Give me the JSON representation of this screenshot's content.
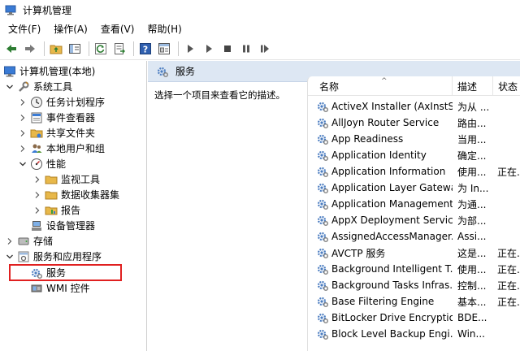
{
  "window": {
    "title": "计算机管理"
  },
  "menu": [
    "文件(F)",
    "操作(A)",
    "查看(V)",
    "帮助(H)"
  ],
  "tree": {
    "root": "计算机管理(本地)",
    "system_tools": "系统工具",
    "task_scheduler": "任务计划程序",
    "event_viewer": "事件查看器",
    "shared_folders": "共享文件夹",
    "local_users": "本地用户和组",
    "performance": "性能",
    "monitor_tools": "监视工具",
    "data_collector": "数据收集器集",
    "reports": "报告",
    "device_manager": "设备管理器",
    "storage": "存储",
    "services_apps": "服务和应用程序",
    "services": "服务",
    "wmi": "WMI 控件"
  },
  "main": {
    "header": "服务",
    "description": "选择一个项目来查看它的描述。",
    "columns": {
      "name": "名称",
      "desc": "描述",
      "status": "状态"
    },
    "sort_indicator": "^",
    "services": [
      {
        "name": "ActiveX Installer (AxInstSV)",
        "desc": "为从 ...",
        "status": ""
      },
      {
        "name": "AllJoyn Router Service",
        "desc": "路由...",
        "status": ""
      },
      {
        "name": "App Readiness",
        "desc": "当用...",
        "status": ""
      },
      {
        "name": "Application Identity",
        "desc": "确定...",
        "status": ""
      },
      {
        "name": "Application Information",
        "desc": "使用...",
        "status": "正在..."
      },
      {
        "name": "Application Layer Gatewa...",
        "desc": "为 In...",
        "status": ""
      },
      {
        "name": "Application Management",
        "desc": "为通...",
        "status": ""
      },
      {
        "name": "AppX Deployment Servic...",
        "desc": "为部...",
        "status": ""
      },
      {
        "name": "AssignedAccessManager...",
        "desc": "Assi...",
        "status": ""
      },
      {
        "name": "AVCTP 服务",
        "desc": "这是...",
        "status": "正在..."
      },
      {
        "name": "Background Intelligent T...",
        "desc": "使用...",
        "status": "正在..."
      },
      {
        "name": "Background Tasks Infras...",
        "desc": "控制...",
        "status": "正在..."
      },
      {
        "name": "Base Filtering Engine",
        "desc": "基本...",
        "status": "正在..."
      },
      {
        "name": "BitLocker Drive Encryptio...",
        "desc": "BDE...",
        "status": ""
      },
      {
        "name": "Block Level Backup Engi...",
        "desc": "Win...",
        "status": ""
      }
    ]
  },
  "colors": {
    "header_bg": "#dde7f3",
    "highlight": "#e02020",
    "gear": "#4a7cc0"
  }
}
